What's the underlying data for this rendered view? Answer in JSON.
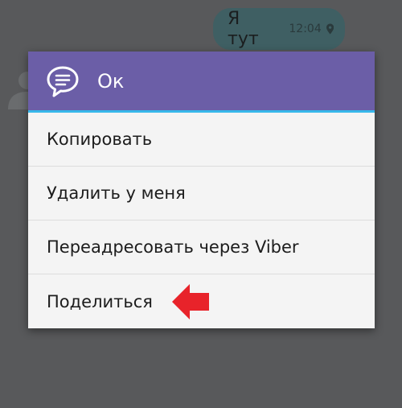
{
  "chat": {
    "message_text": "Я тут",
    "message_time": "12:04",
    "location_icon": "location-pin-icon",
    "bubble_color": "#3f5f63"
  },
  "dialog": {
    "title": "Ок",
    "header_icon": "chat-bubble-icon",
    "header_color": "#6b5ea7",
    "accent_color": "#37b8ea",
    "items": [
      {
        "label": "Копировать"
      },
      {
        "label": "Удалить у меня"
      },
      {
        "label": "Переадресовать через Viber"
      },
      {
        "label": "Поделиться"
      }
    ]
  },
  "annotation": {
    "arrow_icon": "red-arrow-left-icon",
    "arrow_color": "#e8232a"
  }
}
